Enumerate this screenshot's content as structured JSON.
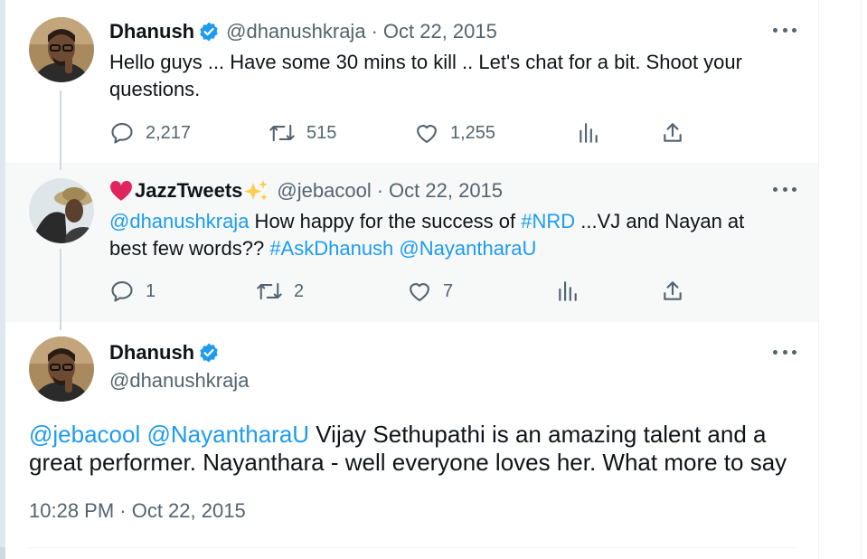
{
  "tweet1": {
    "name": "Dhanush",
    "handle": "@dhanushkraja",
    "separator": "·",
    "date": "Oct 22, 2015",
    "text": "Hello guys ... Have some 30 mins to kill .. Let's chat for a bit. Shoot your questions.",
    "replies": "2,217",
    "retweets": "515",
    "likes": "1,255"
  },
  "tweet2": {
    "name_emoji_left": "❤️",
    "name": "JazzTweets",
    "name_emoji_right": "✨",
    "handle": "@jebacool",
    "separator": "·",
    "date": "Oct 22, 2015",
    "mention1": "@dhanushkraja",
    "text_part1": " How happy for the success of ",
    "hashtag1": "#NRD",
    "text_part2": " ...VJ and Nayan at best few words?? ",
    "hashtag2": "#AskDhanush",
    "space": " ",
    "mention2": "@NayantharaU",
    "replies": "1",
    "retweets": "2",
    "likes": "7"
  },
  "tweet3": {
    "name": "Dhanush",
    "handle": "@dhanushkraja",
    "mention1": "@jebacool",
    "space": " ",
    "mention2": "@NayantharaU",
    "text": " Vijay Sethupathi is an amazing talent and a great performer. Nayanthara - well everyone loves her. What more to say",
    "timestamp": "10:28 PM · Oct 22, 2015"
  },
  "colors": {
    "link": "#1d9bf0",
    "verified": "#1d9bf0",
    "secondary_text": "#536471",
    "primary_text": "#0f1419",
    "heart": "#e0245e",
    "sparkle": "#ffcc4d"
  },
  "icons": [
    "verified-badge-icon",
    "more-icon",
    "reply-icon",
    "retweet-icon",
    "like-icon",
    "views-icon",
    "share-icon"
  ]
}
